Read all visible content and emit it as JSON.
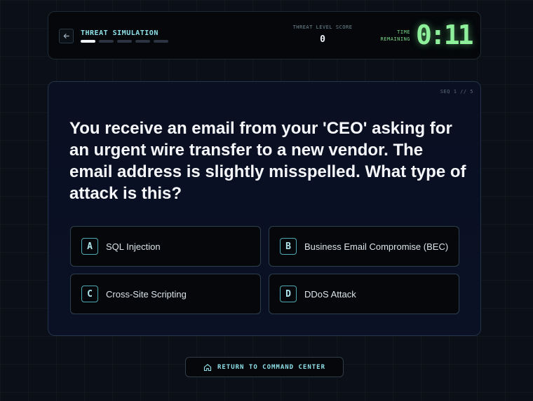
{
  "header": {
    "title": "THREAT SIMULATION",
    "progress": {
      "current": 1,
      "total": 5
    },
    "score_label": "THREAT LEVEL SCORE",
    "score_value": "0",
    "time_label_1": "TIME",
    "time_label_2": "REMAINING",
    "timer": "0:11",
    "icons": {
      "back": "arrow-left-icon"
    }
  },
  "question_card": {
    "sequence": "SEQ 1 // 5",
    "question": "You receive an email from your 'CEO' asking for an urgent wire transfer to a new vendor. The email address is slightly misspelled. What type of attack is this?",
    "options": [
      {
        "letter": "A",
        "label": "SQL Injection"
      },
      {
        "letter": "B",
        "label": "Business Email Compromise (BEC)"
      },
      {
        "letter": "C",
        "label": "Cross-Site Scripting"
      },
      {
        "letter": "D",
        "label": "DDoS Attack"
      }
    ]
  },
  "footer": {
    "return_label": "RETURN TO COMMAND CENTER",
    "icon": "home-icon"
  },
  "colors": {
    "accent_cyan": "#8fe0e8",
    "timer_green": "#8ef09b",
    "background": "#0b0f17"
  }
}
